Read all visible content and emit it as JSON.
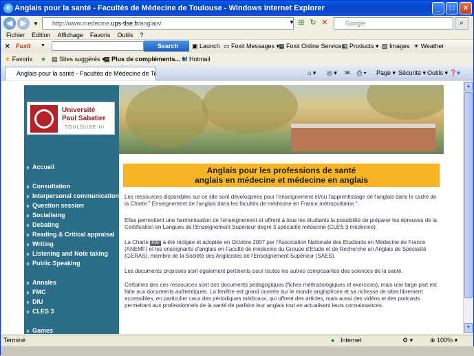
{
  "window": {
    "title": "Anglais pour la santé - Facultés de Médecine de Toulouse - Windows Internet Explorer"
  },
  "address": {
    "url_prefix": "http://www.medecine.",
    "url_domain": "ups-tlse.fr",
    "url_suffix": "/anglais/",
    "search_placeholder": "Google"
  },
  "menu": [
    "Fichier",
    "Edition",
    "Affichage",
    "Favoris",
    "Outils",
    "?"
  ],
  "foxit_toolbar": {
    "brand": "Foxit",
    "search_button": "Search",
    "items": [
      "Launch",
      "Foxit Messages",
      "Foxit Online Services",
      "Products",
      "Images",
      "Weather"
    ]
  },
  "favorites_bar": {
    "favorites": "Favoris",
    "items": [
      "Sites suggérés",
      "Plus de compléments...",
      "Hotmail"
    ]
  },
  "tab": {
    "title": "Anglais pour la santé - Facultés de Médecine de Toulo...",
    "right_items": [
      "Page",
      "Sécurité",
      "Outils"
    ]
  },
  "site": {
    "logo_line1": "Université",
    "logo_line2": "Paul Sabatier",
    "logo_line3": "TOULOUSE III",
    "nav": [
      "Accueil",
      "Consultation",
      "Interpersonal communication",
      "Question session",
      "Socialising",
      "Debating",
      "Reading & Critical appraisal",
      "Writing",
      "Listening and Note taking",
      "Public Speaking",
      "Annales",
      "FMC",
      "DIU",
      "CLES 3",
      "Games"
    ],
    "banner_line1": "Anglais pour les professions de santé",
    "banner_line2": "anglais en médecine et médecine en anglais",
    "para1": "Les ressources disponibles sur ce site sont développées pour l'enseignement et/ou l'apprentissage de l'anglais dans le cadre de la Charte \" Enseignement de l'anglais dans les facultés de médecine en France métropolitaine \".",
    "para2": "Elles permettent une harmonisation de l'enseignement et offrent à tous les étudiants la possibilité de préparer les épreuves de la Certification en Langues de l'Enseignement Supérieur degré 3 spécialité médecine (CLES 3 médecine).",
    "para3_a": "La Charte",
    "para3_pdf": "PDF",
    "para3_b": "a été rédigée et adoptée en Octobre 2007 par l'Association Nationale des Etudiants en Médecine de France (ANEMF) et les enseignants d'anglais en Faculté de médecine du Groupe d'Etude et de Recherche en Anglais de Spécialité (GERAS), membre de la Société des Anglicistes de l'Enseignement Supérieur (SAES).",
    "para4": "Les documents proposés sont également pertinents pour toutes les autres composantes des sciences de la santé.",
    "para5": "Certaines des ces ressources sont des documents pédagogiques (fiches méthodologiques et exercices), mais une large part est faite aux documents authentiques. La fenêtre est grand ouverte sur le monde anglophone et sa richesse de sites librement accessibles, en particulier ceux des périodiques médicaux, qui offrent des articles, mais aussi des vidéos et des podcasts permettant aux professionnels de la santé de parfaire leur anglais tout en actualisant leurs connaissances."
  },
  "status": {
    "left": "Terminé",
    "zone": "Internet",
    "zoom": "100%"
  }
}
